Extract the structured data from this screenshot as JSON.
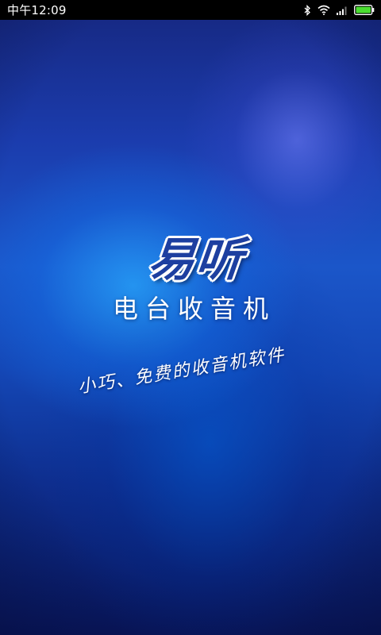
{
  "status_bar": {
    "time": "中午12:09",
    "battery_color": "#4ade30"
  },
  "splash": {
    "logo": "易听",
    "subtitle": "电台收音机",
    "slogan": "小巧、免费的收音机软件"
  },
  "colors": {
    "status_bar_bg": "#000000",
    "background_top": "#16277f",
    "background_mid": "#1b56c9",
    "background_bottom": "#081559",
    "logo_fill": "#1d3fa0",
    "text": "#ffffff"
  }
}
